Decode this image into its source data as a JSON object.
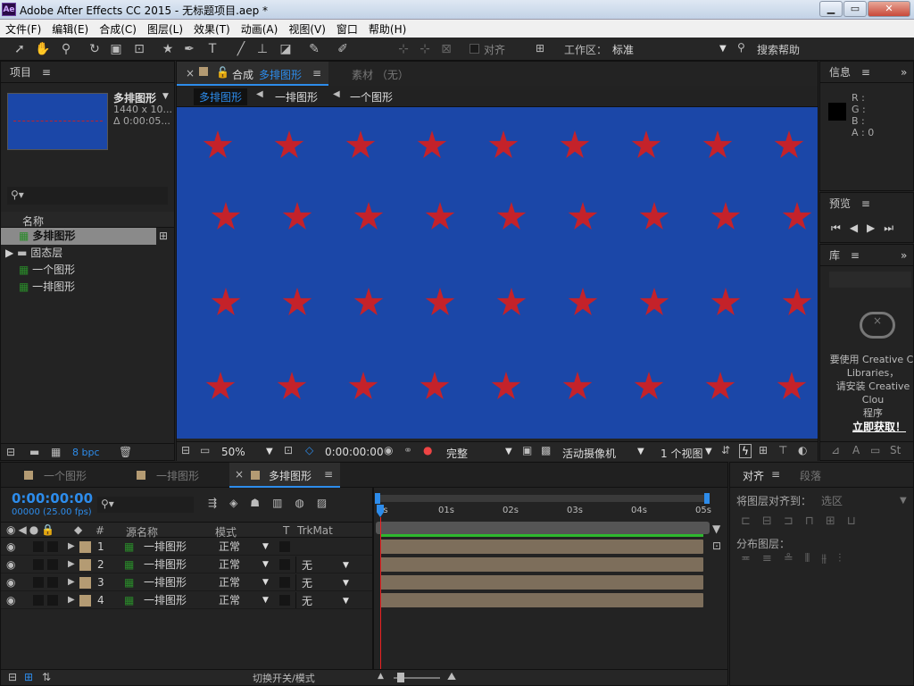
{
  "titlebar": {
    "title": "Adobe After Effects CC 2015 - 无标题项目.aep *",
    "icon": "Ae",
    "min": "▁",
    "max": "▭",
    "close": "✕"
  },
  "menu": [
    "文件(F)",
    "编辑(E)",
    "合成(C)",
    "图层(L)",
    "效果(T)",
    "动画(A)",
    "视图(V)",
    "窗口",
    "帮助(H)"
  ],
  "toolbar": {
    "snap_label": "对齐",
    "workspace_label": "工作区：",
    "workspace_value": "标准",
    "search_label": "搜索帮助"
  },
  "project": {
    "title": "项目",
    "preview_name": "多排图形",
    "preview_info1": "1440 x 10...",
    "preview_info2": "Δ 0:00:05...",
    "col_name": "名称",
    "items": [
      "多排图形",
      "固态层",
      "一个图形",
      "一排图形"
    ],
    "bpc": "8 bpc"
  },
  "composition": {
    "tab_prefix": "合成",
    "tab_name": "多排图形",
    "footage_tab": "素材 （无）",
    "breadcrumbs": [
      "多排图形",
      "一排图形",
      "一个图形"
    ],
    "zoom": "50%",
    "timecode": "0:00:00:00",
    "resolution": "完整",
    "camera": "活动摄像机",
    "views": "1 个视图"
  },
  "info": {
    "title": "信息",
    "r": "R :",
    "g": "G :",
    "b": "B :",
    "a": "A : 0"
  },
  "preview": {
    "title": "预览"
  },
  "library": {
    "title": "库",
    "msg1": "要使用 Creative Cl",
    "msg2": "Libraries，",
    "msg3": "请安装 Creative Clou",
    "msg4": "程序",
    "link": "立即获取！"
  },
  "timeline": {
    "tabs": [
      "一个图形",
      "一排图形",
      "多排图形"
    ],
    "timecode": "0:00:00:00",
    "fps": "00000 (25.00 fps)",
    "headers": {
      "hash": "#",
      "source": "源名称",
      "mode": "模式",
      "t": "T",
      "trkmat": "TrkMat"
    },
    "ruler": [
      "0s",
      "01s",
      "02s",
      "03s",
      "04s",
      "05s"
    ],
    "layers": [
      {
        "num": "1",
        "name": "一排图形",
        "mode": "正常",
        "trkmat": ""
      },
      {
        "num": "2",
        "name": "一排图形",
        "mode": "正常",
        "trkmat": "无"
      },
      {
        "num": "3",
        "name": "一排图形",
        "mode": "正常",
        "trkmat": "无"
      },
      {
        "num": "4",
        "name": "一排图形",
        "mode": "正常",
        "trkmat": "无"
      }
    ],
    "footer": "切换开关/模式"
  },
  "align": {
    "tab1": "对齐",
    "tab2": "段落",
    "align_to_label": "将图层对齐到：",
    "align_to_value": "选区",
    "distribute": "分布图层："
  },
  "colors": {
    "canvas": "#1b47a8",
    "star": "#c4222a",
    "accent": "#2d8ceb",
    "timecode": "#2d8ceb",
    "layer_bar": "#7d6e5b"
  }
}
